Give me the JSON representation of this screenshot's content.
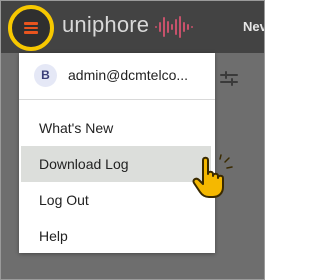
{
  "header": {
    "logo_text": "uniphore",
    "right_label": "Nev"
  },
  "account": {
    "avatar_initial": "B",
    "email": "admin@dcmtelco..."
  },
  "menu": {
    "items": [
      {
        "label": "What's New"
      },
      {
        "label": "Download Log"
      },
      {
        "label": "Log Out"
      },
      {
        "label": "Help"
      }
    ]
  },
  "colors": {
    "menu_icon": "#e8541e",
    "highlight_ring": "#f7c800",
    "brand_wave": "#c7526b",
    "hover_row": "#dcdedb",
    "cursor_fill": "#f5b800"
  }
}
